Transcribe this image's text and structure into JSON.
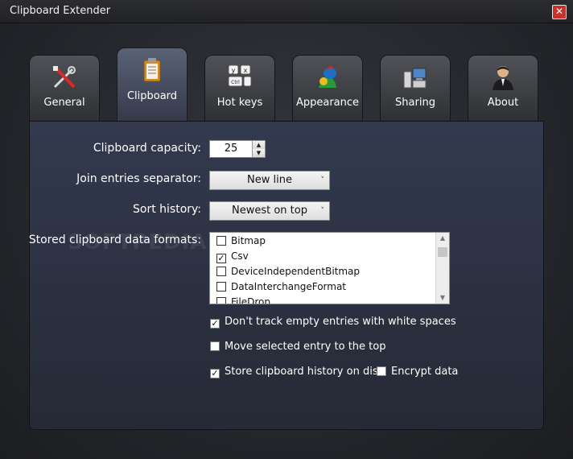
{
  "window": {
    "title": "Clipboard Extender",
    "close_glyph": "✕"
  },
  "tabs": [
    {
      "label": "General",
      "icon": "tools-icon",
      "active": false
    },
    {
      "label": "Clipboard",
      "icon": "clipboard-icon",
      "active": true
    },
    {
      "label": "Hot keys",
      "icon": "keyboard-icon",
      "active": false
    },
    {
      "label": "Appearance",
      "icon": "paint-icon",
      "active": false
    },
    {
      "label": "Sharing",
      "icon": "network-icon",
      "active": false
    },
    {
      "label": "About",
      "icon": "person-icon",
      "active": false
    }
  ],
  "form": {
    "capacity": {
      "label": "Clipboard capacity:",
      "value": "25"
    },
    "separator": {
      "label": "Join entries separator:",
      "value": "New line"
    },
    "sort": {
      "label": "Sort history:",
      "value": "Newest on top"
    },
    "formats": {
      "label": "Stored clipboard data formats:",
      "items": [
        {
          "label": "Bitmap",
          "checked": false
        },
        {
          "label": "Csv",
          "checked": true
        },
        {
          "label": "DeviceIndependentBitmap",
          "checked": false
        },
        {
          "label": "DataInterchangeFormat",
          "checked": false
        },
        {
          "label": "FileDrop",
          "checked": false
        }
      ]
    }
  },
  "options": {
    "dont_track_empty": {
      "label": "Don't track empty entries with white spaces",
      "checked": true
    },
    "move_selected_top": {
      "label": "Move selected entry to the top",
      "checked": false
    },
    "store_on_disk": {
      "label": "Store clipboard history on disk",
      "checked": true
    },
    "encrypt": {
      "label": "Encrypt data",
      "checked": false
    }
  },
  "watermark": "SOFTPEDIA",
  "glyphs": {
    "check": "✓",
    "combo_arrow": "˅",
    "up": "▲",
    "down": "▼"
  },
  "colors": {
    "active_tab": "#4a5167",
    "panel": "#2e3446",
    "close": "#c8312c"
  }
}
